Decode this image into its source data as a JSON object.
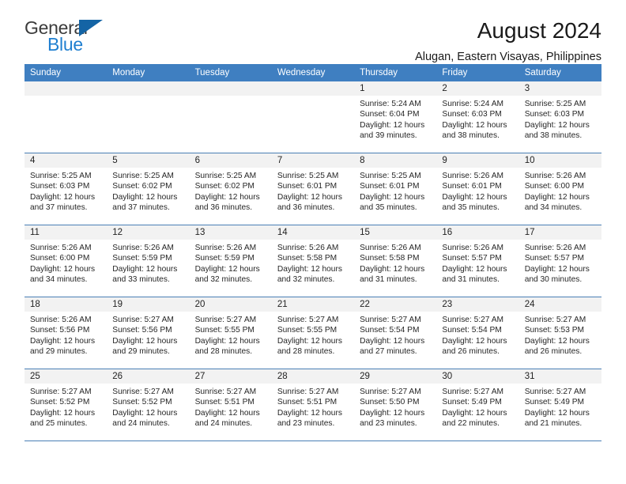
{
  "brand": {
    "name_part1": "General",
    "name_part2": "Blue",
    "logo_icon": "triangle-logo-icon",
    "accent_color": "#1f7fd0"
  },
  "header": {
    "title": "August 2024",
    "location": "Alugan, Eastern Visayas, Philippines"
  },
  "colors": {
    "header_row_background": "#3f7fc1",
    "header_row_text": "#ffffff",
    "daynum_band": "#f2f2f2",
    "row_divider": "#4a7fb5"
  },
  "weekday_headers": [
    "Sunday",
    "Monday",
    "Tuesday",
    "Wednesday",
    "Thursday",
    "Friday",
    "Saturday"
  ],
  "weeks": [
    [
      {
        "day": "",
        "lines": []
      },
      {
        "day": "",
        "lines": []
      },
      {
        "day": "",
        "lines": []
      },
      {
        "day": "",
        "lines": []
      },
      {
        "day": "1",
        "lines": [
          "Sunrise: 5:24 AM",
          "Sunset: 6:04 PM",
          "Daylight: 12 hours",
          "and 39 minutes."
        ]
      },
      {
        "day": "2",
        "lines": [
          "Sunrise: 5:24 AM",
          "Sunset: 6:03 PM",
          "Daylight: 12 hours",
          "and 38 minutes."
        ]
      },
      {
        "day": "3",
        "lines": [
          "Sunrise: 5:25 AM",
          "Sunset: 6:03 PM",
          "Daylight: 12 hours",
          "and 38 minutes."
        ]
      }
    ],
    [
      {
        "day": "4",
        "lines": [
          "Sunrise: 5:25 AM",
          "Sunset: 6:03 PM",
          "Daylight: 12 hours",
          "and 37 minutes."
        ]
      },
      {
        "day": "5",
        "lines": [
          "Sunrise: 5:25 AM",
          "Sunset: 6:02 PM",
          "Daylight: 12 hours",
          "and 37 minutes."
        ]
      },
      {
        "day": "6",
        "lines": [
          "Sunrise: 5:25 AM",
          "Sunset: 6:02 PM",
          "Daylight: 12 hours",
          "and 36 minutes."
        ]
      },
      {
        "day": "7",
        "lines": [
          "Sunrise: 5:25 AM",
          "Sunset: 6:01 PM",
          "Daylight: 12 hours",
          "and 36 minutes."
        ]
      },
      {
        "day": "8",
        "lines": [
          "Sunrise: 5:25 AM",
          "Sunset: 6:01 PM",
          "Daylight: 12 hours",
          "and 35 minutes."
        ]
      },
      {
        "day": "9",
        "lines": [
          "Sunrise: 5:26 AM",
          "Sunset: 6:01 PM",
          "Daylight: 12 hours",
          "and 35 minutes."
        ]
      },
      {
        "day": "10",
        "lines": [
          "Sunrise: 5:26 AM",
          "Sunset: 6:00 PM",
          "Daylight: 12 hours",
          "and 34 minutes."
        ]
      }
    ],
    [
      {
        "day": "11",
        "lines": [
          "Sunrise: 5:26 AM",
          "Sunset: 6:00 PM",
          "Daylight: 12 hours",
          "and 34 minutes."
        ]
      },
      {
        "day": "12",
        "lines": [
          "Sunrise: 5:26 AM",
          "Sunset: 5:59 PM",
          "Daylight: 12 hours",
          "and 33 minutes."
        ]
      },
      {
        "day": "13",
        "lines": [
          "Sunrise: 5:26 AM",
          "Sunset: 5:59 PM",
          "Daylight: 12 hours",
          "and 32 minutes."
        ]
      },
      {
        "day": "14",
        "lines": [
          "Sunrise: 5:26 AM",
          "Sunset: 5:58 PM",
          "Daylight: 12 hours",
          "and 32 minutes."
        ]
      },
      {
        "day": "15",
        "lines": [
          "Sunrise: 5:26 AM",
          "Sunset: 5:58 PM",
          "Daylight: 12 hours",
          "and 31 minutes."
        ]
      },
      {
        "day": "16",
        "lines": [
          "Sunrise: 5:26 AM",
          "Sunset: 5:57 PM",
          "Daylight: 12 hours",
          "and 31 minutes."
        ]
      },
      {
        "day": "17",
        "lines": [
          "Sunrise: 5:26 AM",
          "Sunset: 5:57 PM",
          "Daylight: 12 hours",
          "and 30 minutes."
        ]
      }
    ],
    [
      {
        "day": "18",
        "lines": [
          "Sunrise: 5:26 AM",
          "Sunset: 5:56 PM",
          "Daylight: 12 hours",
          "and 29 minutes."
        ]
      },
      {
        "day": "19",
        "lines": [
          "Sunrise: 5:27 AM",
          "Sunset: 5:56 PM",
          "Daylight: 12 hours",
          "and 29 minutes."
        ]
      },
      {
        "day": "20",
        "lines": [
          "Sunrise: 5:27 AM",
          "Sunset: 5:55 PM",
          "Daylight: 12 hours",
          "and 28 minutes."
        ]
      },
      {
        "day": "21",
        "lines": [
          "Sunrise: 5:27 AM",
          "Sunset: 5:55 PM",
          "Daylight: 12 hours",
          "and 28 minutes."
        ]
      },
      {
        "day": "22",
        "lines": [
          "Sunrise: 5:27 AM",
          "Sunset: 5:54 PM",
          "Daylight: 12 hours",
          "and 27 minutes."
        ]
      },
      {
        "day": "23",
        "lines": [
          "Sunrise: 5:27 AM",
          "Sunset: 5:54 PM",
          "Daylight: 12 hours",
          "and 26 minutes."
        ]
      },
      {
        "day": "24",
        "lines": [
          "Sunrise: 5:27 AM",
          "Sunset: 5:53 PM",
          "Daylight: 12 hours",
          "and 26 minutes."
        ]
      }
    ],
    [
      {
        "day": "25",
        "lines": [
          "Sunrise: 5:27 AM",
          "Sunset: 5:52 PM",
          "Daylight: 12 hours",
          "and 25 minutes."
        ]
      },
      {
        "day": "26",
        "lines": [
          "Sunrise: 5:27 AM",
          "Sunset: 5:52 PM",
          "Daylight: 12 hours",
          "and 24 minutes."
        ]
      },
      {
        "day": "27",
        "lines": [
          "Sunrise: 5:27 AM",
          "Sunset: 5:51 PM",
          "Daylight: 12 hours",
          "and 24 minutes."
        ]
      },
      {
        "day": "28",
        "lines": [
          "Sunrise: 5:27 AM",
          "Sunset: 5:51 PM",
          "Daylight: 12 hours",
          "and 23 minutes."
        ]
      },
      {
        "day": "29",
        "lines": [
          "Sunrise: 5:27 AM",
          "Sunset: 5:50 PM",
          "Daylight: 12 hours",
          "and 23 minutes."
        ]
      },
      {
        "day": "30",
        "lines": [
          "Sunrise: 5:27 AM",
          "Sunset: 5:49 PM",
          "Daylight: 12 hours",
          "and 22 minutes."
        ]
      },
      {
        "day": "31",
        "lines": [
          "Sunrise: 5:27 AM",
          "Sunset: 5:49 PM",
          "Daylight: 12 hours",
          "and 21 minutes."
        ]
      }
    ]
  ]
}
